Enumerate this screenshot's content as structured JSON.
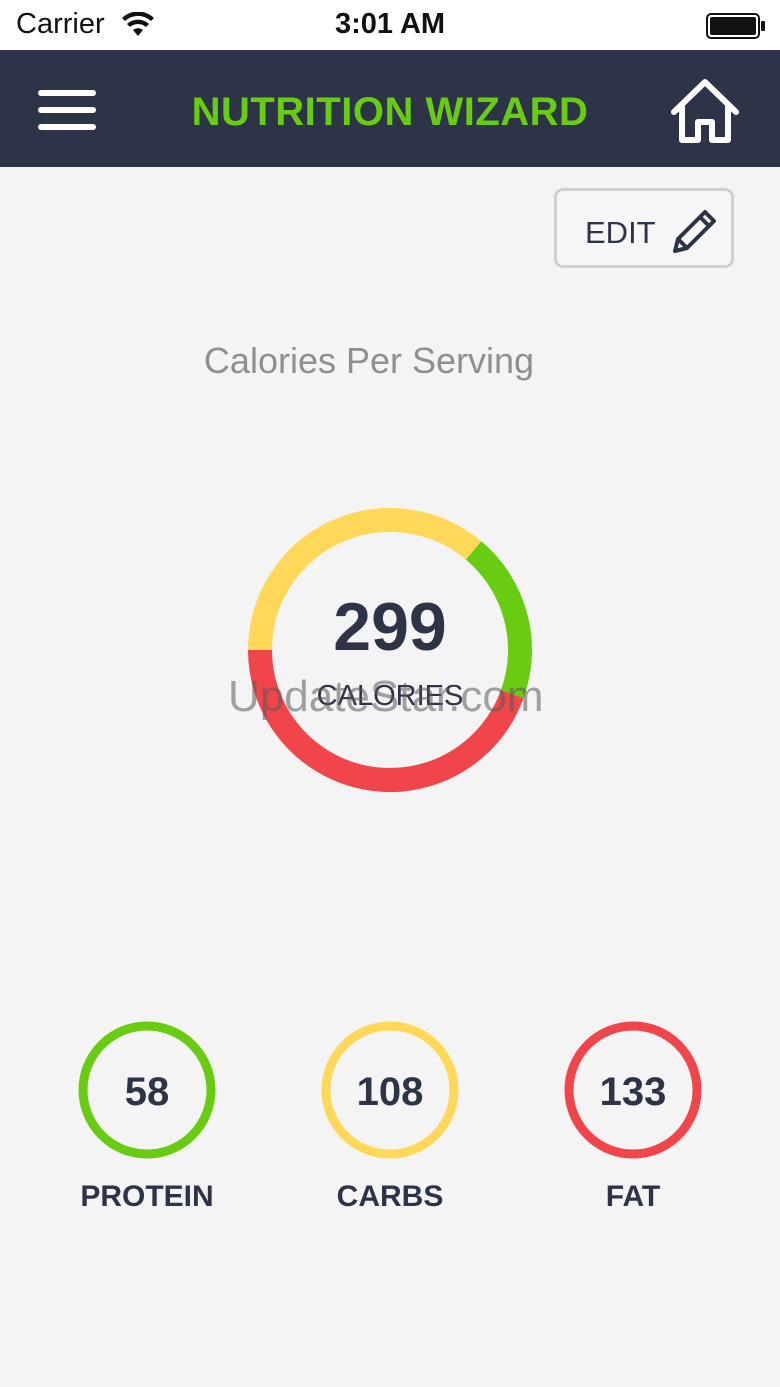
{
  "status_bar": {
    "carrier": "Carrier",
    "time": "3:01 AM"
  },
  "nav": {
    "title": "NUTRITION WIZARD",
    "menu_icon": "hamburger-menu-icon",
    "home_icon": "home-icon"
  },
  "edit_button": {
    "label": "EDIT",
    "icon": "pencil-icon"
  },
  "heading": "Calories Per Serving",
  "calories": {
    "value": "299",
    "label": "CALORIES"
  },
  "watermark": "UpdateStar.com",
  "macros": [
    {
      "value": "58",
      "label": "PROTEIN",
      "color": "#6acc12"
    },
    {
      "value": "108",
      "label": "CARBS",
      "color": "#ffd85a"
    },
    {
      "value": "133",
      "label": "FAT",
      "color": "#f0454b"
    }
  ],
  "colors": {
    "nav_bg": "#2e3448",
    "accent_green": "#6acc12",
    "carbs_yellow": "#ffd85a",
    "fat_red": "#f0454b"
  },
  "chart_data": {
    "type": "pie",
    "categories": [
      "PROTEIN",
      "CARBS",
      "FAT"
    ],
    "values": [
      58,
      108,
      133
    ]
  }
}
